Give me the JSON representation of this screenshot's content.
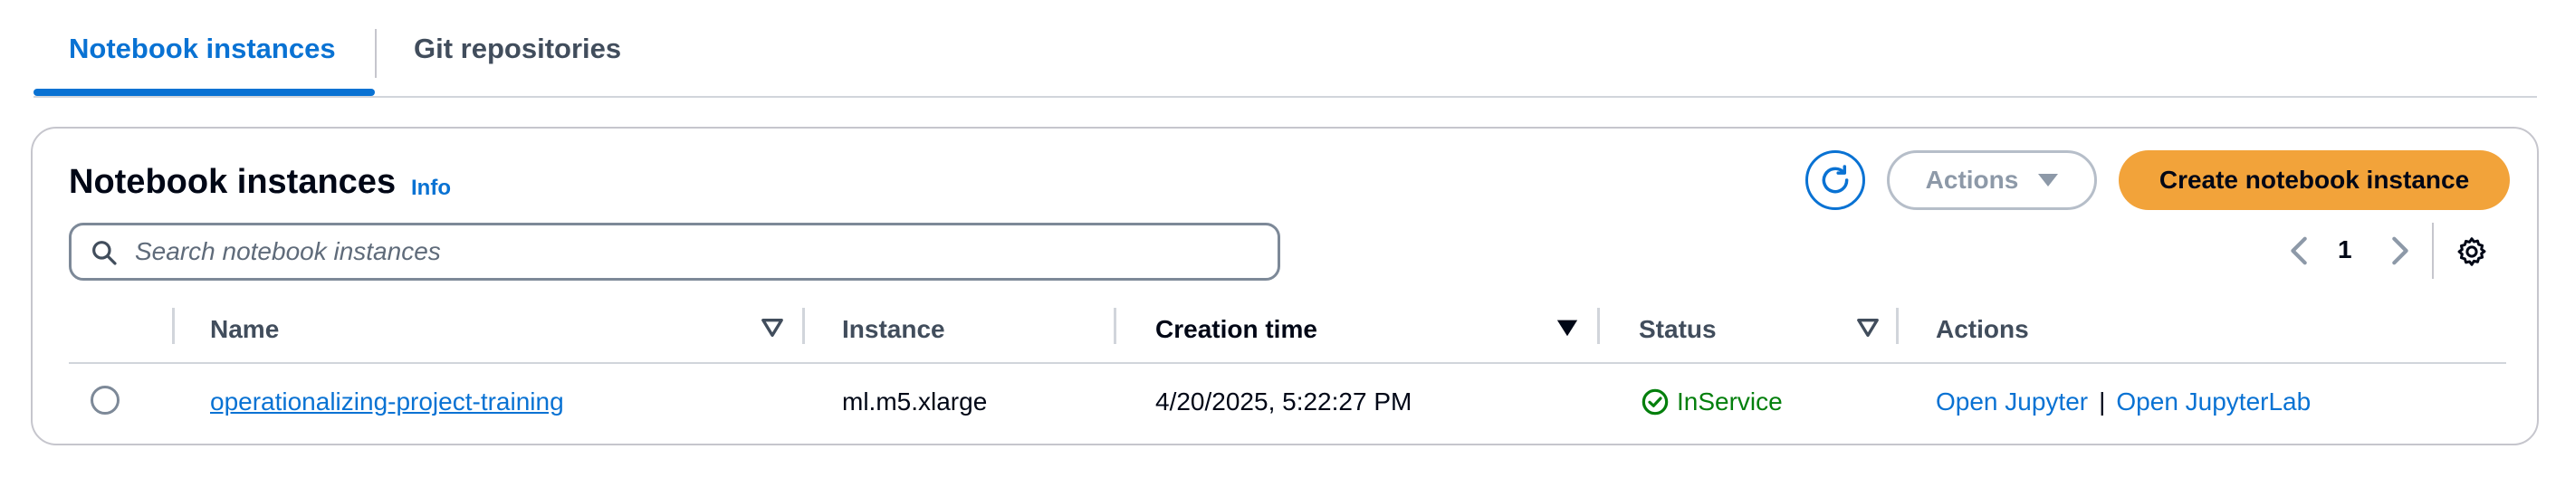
{
  "tabs": [
    {
      "label": "Notebook instances",
      "active": true
    },
    {
      "label": "Git repositories",
      "active": false
    }
  ],
  "panel": {
    "title": "Notebook instances",
    "info_label": "Info",
    "actions_label": "Actions",
    "create_label": "Create notebook instance",
    "search_placeholder": "Search notebook instances",
    "page_number": "1"
  },
  "table": {
    "columns": [
      "Name",
      "Instance",
      "Creation time",
      "Status",
      "Actions"
    ],
    "rows": [
      {
        "name": "operationalizing-project-training",
        "instance": "ml.m5.xlarge",
        "creation_time": "4/20/2025, 5:22:27 PM",
        "status": "InService",
        "action_jupyter": "Open Jupyter",
        "action_separator": "|",
        "action_jupyterlab": "Open JupyterLab"
      }
    ]
  },
  "colors": {
    "accent": "#0972d3",
    "primary_button": "#f2a33a",
    "status_success": "#037f0c"
  },
  "icons": [
    "refresh-icon",
    "caret-down-icon",
    "search-icon",
    "chevron-left-icon",
    "chevron-right-icon",
    "gear-icon",
    "sort-icon",
    "sort-descending-icon",
    "check-circle-icon"
  ]
}
